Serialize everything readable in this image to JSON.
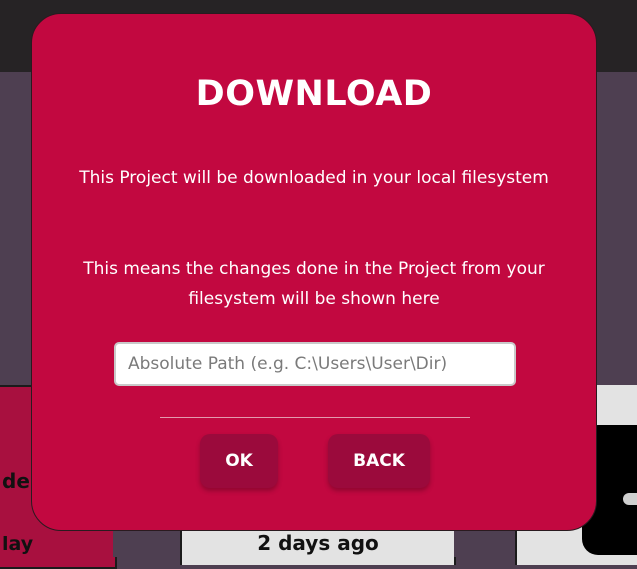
{
  "background": {
    "left_card_title": "de",
    "left_card_sub": "lay",
    "mid_card_sub": "2 days ago"
  },
  "modal": {
    "title": "DOWNLOAD",
    "message1": "This Project will be downloaded in your local filesystem",
    "message2": "This means the changes done in the Project from your filesystem will be shown here",
    "path_placeholder": "Absolute Path (e.g. C:\\Users\\User\\Dir)",
    "ok_label": "OK",
    "back_label": "BACK"
  },
  "colors": {
    "modal_bg": "#c20840",
    "button_bg": "#9b0a3c",
    "app_bg": "#4e3f51",
    "topbar_bg": "#262325"
  }
}
